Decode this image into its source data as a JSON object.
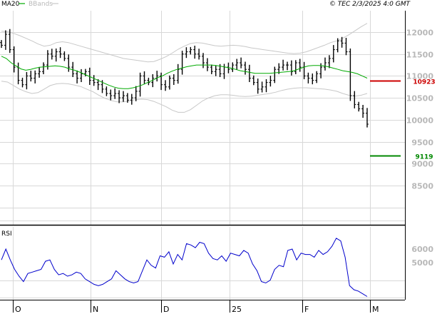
{
  "header": {
    "legend": [
      {
        "label": "MA20",
        "color": "#00aa00"
      },
      {
        "label": "BBands",
        "color": "#c8c8c8"
      }
    ],
    "timestamp": "© TEC 2/3/2025 4:0 GMT"
  },
  "chart_data": [
    {
      "type": "line",
      "subtype": "ohlc-price-with-ma20-and-bollinger-bands",
      "y_ticks": [
        {
          "value": 12000,
          "label": "12000"
        },
        {
          "value": 11500,
          "label": "11500"
        },
        {
          "value": 11000,
          "label": "11000"
        },
        {
          "value": 10500,
          "label": "10500"
        },
        {
          "value": 10000,
          "label": "10000"
        },
        {
          "value": 9500,
          "label": "9500"
        },
        {
          "value": 9000,
          "label": "9000"
        },
        {
          "value": 8500,
          "label": "8500"
        }
      ],
      "ylim": [
        7800,
        12600
      ],
      "x_labels": [
        "O",
        "N",
        "D",
        "25",
        "F",
        "M"
      ],
      "grid": true,
      "markers": [
        {
          "label": "10923",
          "value": 10900,
          "color": "#cc0000"
        },
        {
          "label": "9119",
          "value": 9180,
          "color": "#008800"
        }
      ],
      "close": [
        11700,
        11950,
        11600,
        11200,
        10900,
        10800,
        11000,
        10950,
        11050,
        11100,
        11250,
        11500,
        11450,
        11550,
        11500,
        11400,
        11200,
        11050,
        10950,
        11050,
        11100,
        10900,
        10850,
        10800,
        10700,
        10600,
        10550,
        10600,
        10500,
        10550,
        10450,
        10500,
        10650,
        11000,
        10900,
        10850,
        10950,
        11000,
        10800,
        10750,
        10950,
        10900,
        11150,
        11500,
        11550,
        11600,
        11500,
        11450,
        11300,
        11200,
        11100,
        11150,
        11050,
        11200,
        11150,
        11250,
        11300,
        11250,
        11150,
        10950,
        10850,
        10700,
        10750,
        10850,
        10900,
        11150,
        11200,
        11250,
        11250,
        11100,
        11300,
        11200,
        11000,
        10950,
        10900,
        11050,
        11200,
        11300,
        11400,
        11600,
        11800,
        11750,
        11550,
        10550,
        10350,
        10250,
        10150,
        9900
      ],
      "ma20": [
        11450,
        11400,
        11300,
        11230,
        11160,
        11130,
        11150,
        11180,
        11200,
        11210,
        11220,
        11230,
        11220,
        11200,
        11160,
        11130,
        11090,
        11040,
        10990,
        10940,
        10890,
        10840,
        10790,
        10750,
        10720,
        10710,
        10710,
        10730,
        10760,
        10800,
        10850,
        10900,
        10960,
        11000,
        11060,
        11110,
        11150,
        11180,
        11210,
        11230,
        11250,
        11250,
        11250,
        11250,
        11240,
        11220,
        11200,
        11180,
        11150,
        11120,
        11100,
        11080,
        11060,
        11060,
        11060,
        11060,
        11070,
        11080,
        11090,
        11100,
        11120,
        11160,
        11200,
        11230,
        11240,
        11240,
        11230,
        11210,
        11180,
        11150,
        11120,
        11100,
        11080,
        11050,
        11000,
        10950
      ],
      "bb_upper": [
        12020,
        12010,
        11970,
        11920,
        11860,
        11800,
        11730,
        11680,
        11700,
        11760,
        11780,
        11760,
        11720,
        11680,
        11640,
        11600,
        11560,
        11520,
        11480,
        11440,
        11400,
        11380,
        11360,
        11340,
        11320,
        11330,
        11380,
        11440,
        11520,
        11610,
        11680,
        11740,
        11760,
        11750,
        11720,
        11690,
        11680,
        11690,
        11700,
        11690,
        11670,
        11640,
        11620,
        11600,
        11580,
        11560,
        11540,
        11520,
        11510,
        11520,
        11550,
        11600,
        11650,
        11700,
        11760,
        11800,
        11860,
        11940,
        12030,
        12120,
        12200
      ],
      "bb_lower": [
        10880,
        10860,
        10780,
        10700,
        10640,
        10600,
        10620,
        10700,
        10780,
        10820,
        10830,
        10820,
        10790,
        10760,
        10700,
        10640,
        10560,
        10490,
        10440,
        10410,
        10410,
        10430,
        10460,
        10470,
        10460,
        10420,
        10360,
        10300,
        10220,
        10170,
        10170,
        10230,
        10330,
        10430,
        10500,
        10550,
        10570,
        10570,
        10560,
        10540,
        10530,
        10540,
        10560,
        10580,
        10600,
        10630,
        10670,
        10700,
        10720,
        10730,
        10730,
        10720,
        10710,
        10700,
        10680,
        10650,
        10600,
        10560,
        10540,
        10560,
        10600
      ],
      "ohlc_style": {
        "bar_color": "#000000"
      },
      "ma_color": "#00aa00",
      "band_color": "#c8c8c8"
    },
    {
      "type": "line",
      "title": "RSI",
      "y_ticks": [
        {
          "value": 60,
          "label": "6000"
        },
        {
          "value": 50,
          "label": "5000"
        }
      ],
      "ylim": [
        24,
        83
      ],
      "values": [
        52,
        60,
        52,
        45,
        40,
        36,
        42,
        43,
        44,
        45,
        51,
        52,
        45,
        41,
        42,
        40,
        41,
        43,
        42,
        38,
        36,
        34,
        33,
        34,
        36,
        38,
        44,
        41,
        38,
        36,
        35,
        36,
        44,
        52,
        48,
        46,
        55,
        54,
        58,
        49,
        56,
        52,
        64,
        63,
        61,
        65,
        64,
        57,
        53,
        52,
        55,
        51,
        57,
        56,
        55,
        59,
        57,
        49,
        44,
        36,
        35,
        37,
        45,
        48,
        47,
        59,
        60,
        52,
        57,
        56,
        56,
        54,
        59,
        56,
        58,
        62,
        68,
        66,
        54,
        33,
        30,
        29,
        27,
        25
      ],
      "color": "#0000cc"
    }
  ]
}
